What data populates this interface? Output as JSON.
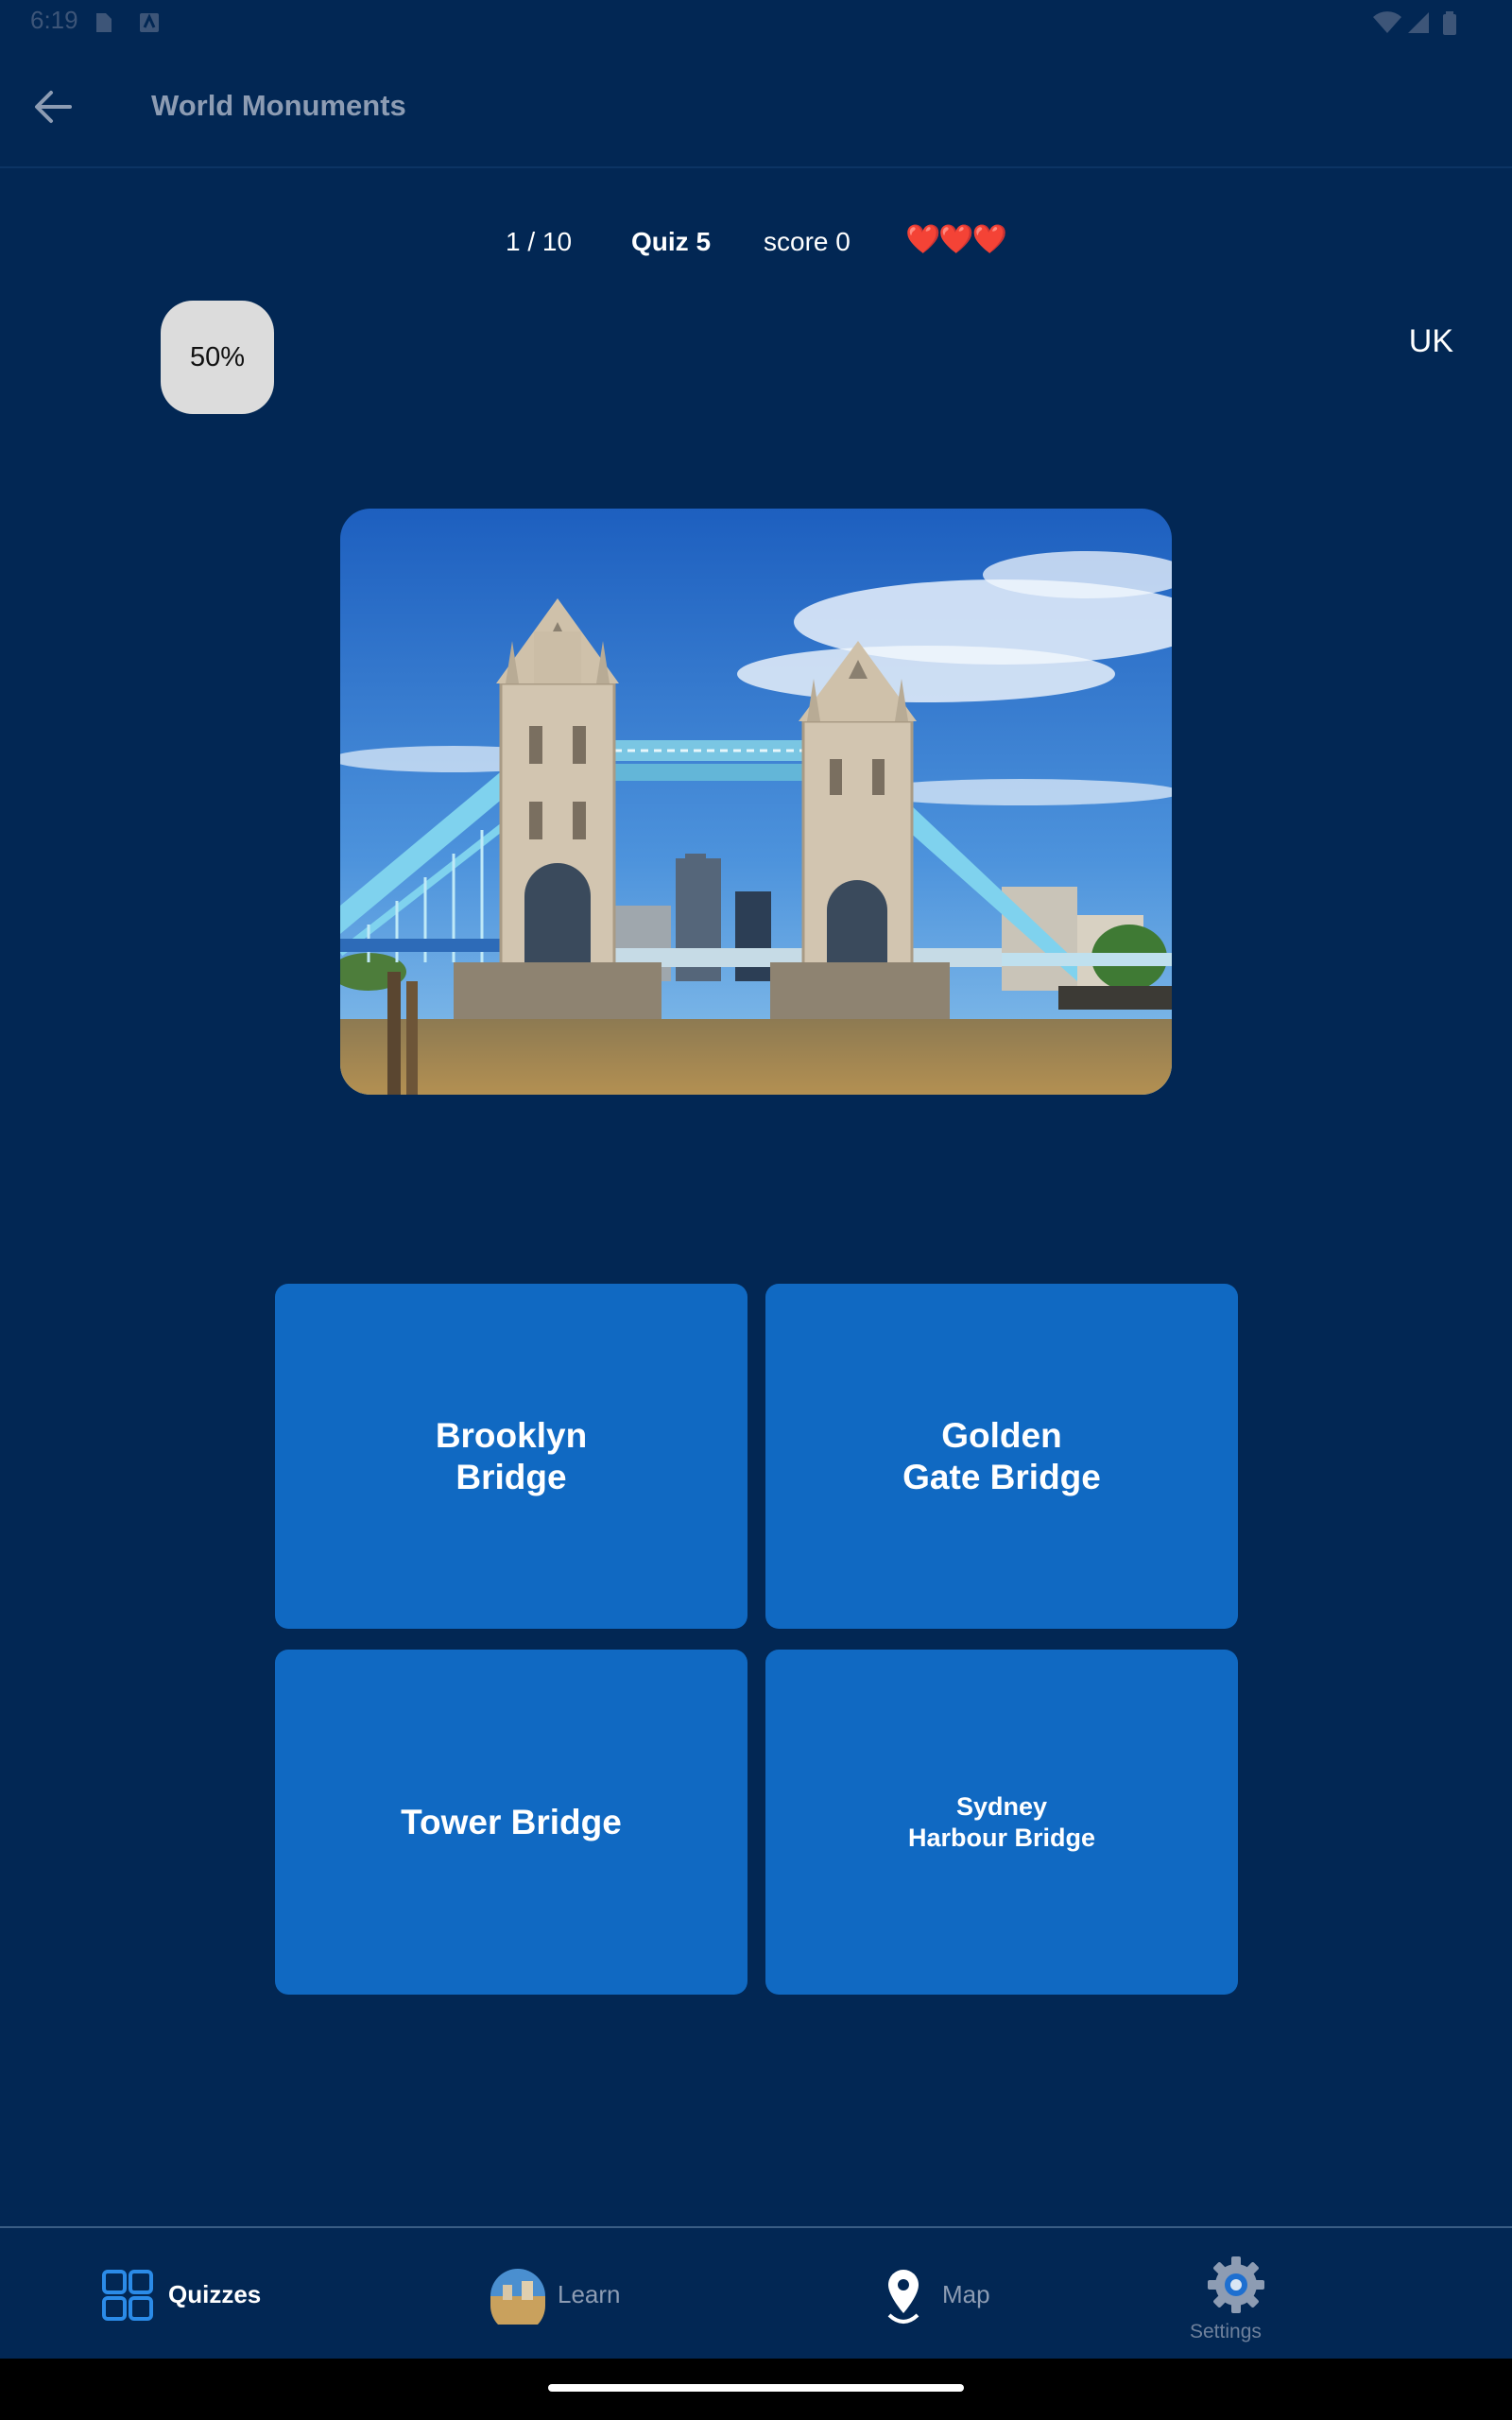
{
  "status": {
    "time": "6:19"
  },
  "appbar": {
    "title": "World Monuments"
  },
  "quiz": {
    "progress": "1 / 10",
    "quiz_label": "Quiz 5",
    "score": "score 0",
    "lives": "❤️❤️❤️",
    "lifeline": "50%",
    "hint": "UK"
  },
  "answers": [
    {
      "label": "Brooklyn\nBridge"
    },
    {
      "label": "Golden\nGate Bridge"
    },
    {
      "label": "Tower Bridge"
    },
    {
      "label": "Sydney\nHarbour Bridge"
    }
  ],
  "nav": {
    "quizzes": "Quizzes",
    "learn": "Learn",
    "map": "Map",
    "settings": "Settings"
  },
  "colors": {
    "background": "#022754",
    "answer_button": "#1069c2",
    "accent": "#2b8be8"
  }
}
